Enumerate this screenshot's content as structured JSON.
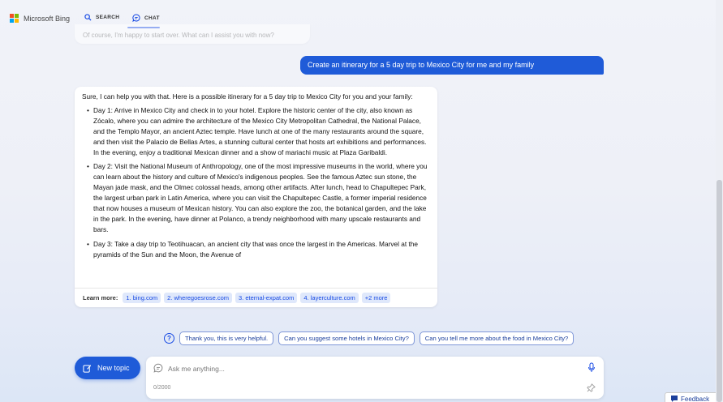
{
  "header": {
    "brand": "Microsoft Bing",
    "tabs": [
      {
        "label": "SEARCH",
        "icon": "search-icon"
      },
      {
        "label": "CHAT",
        "icon": "chat-icon",
        "active": true
      }
    ]
  },
  "faded_message": "Of course, I'm happy to start over. What can I assist you with now?",
  "user_message": "Create an itinerary for a 5 day trip to Mexico City for me and my family",
  "bot_message": {
    "intro": "Sure, I can help you with that. Here is a possible itinerary for a 5 day trip to Mexico City for you and your family:",
    "items": [
      "Day 1: Arrive in Mexico City and check in to your hotel. Explore the historic center of the city, also known as Zócalo, where you can admire the architecture of the Mexico City Metropolitan Cathedral, the National Palace, and the Templo Mayor, an ancient Aztec temple. Have lunch at one of the many restaurants around the square, and then visit the Palacio de Bellas Artes, a stunning cultural center that hosts art exhibitions and performances. In the evening, enjoy a traditional Mexican dinner and a show of mariachi music at Plaza Garibaldi.",
      "Day 2: Visit the National Museum of Anthropology, one of the most impressive museums in the world, where you can learn about the history and culture of Mexico's indigenous peoples. See the famous Aztec sun stone, the Mayan jade mask, and the Olmec colossal heads, among other artifacts. After lunch, head to Chapultepec Park, the largest urban park in Latin America, where you can visit the Chapultepec Castle, a former imperial residence that now houses a museum of Mexican history. You can also explore the zoo, the botanical garden, and the lake in the park. In the evening, have dinner at Polanco, a trendy neighborhood with many upscale restaurants and bars.",
      "Day 3: Take a day trip to Teotihuacan, an ancient city that was once the largest in the Americas. Marvel at the pyramids of the Sun and the Moon, the Avenue of"
    ],
    "learn_more_label": "Learn more:",
    "links": [
      "1. bing.com",
      "2. wheregoesrose.com",
      "3. eternal-expat.com",
      "4. layerculture.com",
      "+2 more"
    ]
  },
  "suggestions": [
    "Thank you, this is very helpful.",
    "Can you suggest some hotels in Mexico City?",
    "Can you tell me more about the food in Mexico City?"
  ],
  "new_topic_label": "New topic",
  "input": {
    "placeholder": "Ask me anything...",
    "value": "",
    "char_count": "0/2000"
  },
  "feedback_label": "Feedback",
  "colors": {
    "accent": "#1f5bd8",
    "link": "#174ae4",
    "link_bg": "#dfe8fb"
  }
}
